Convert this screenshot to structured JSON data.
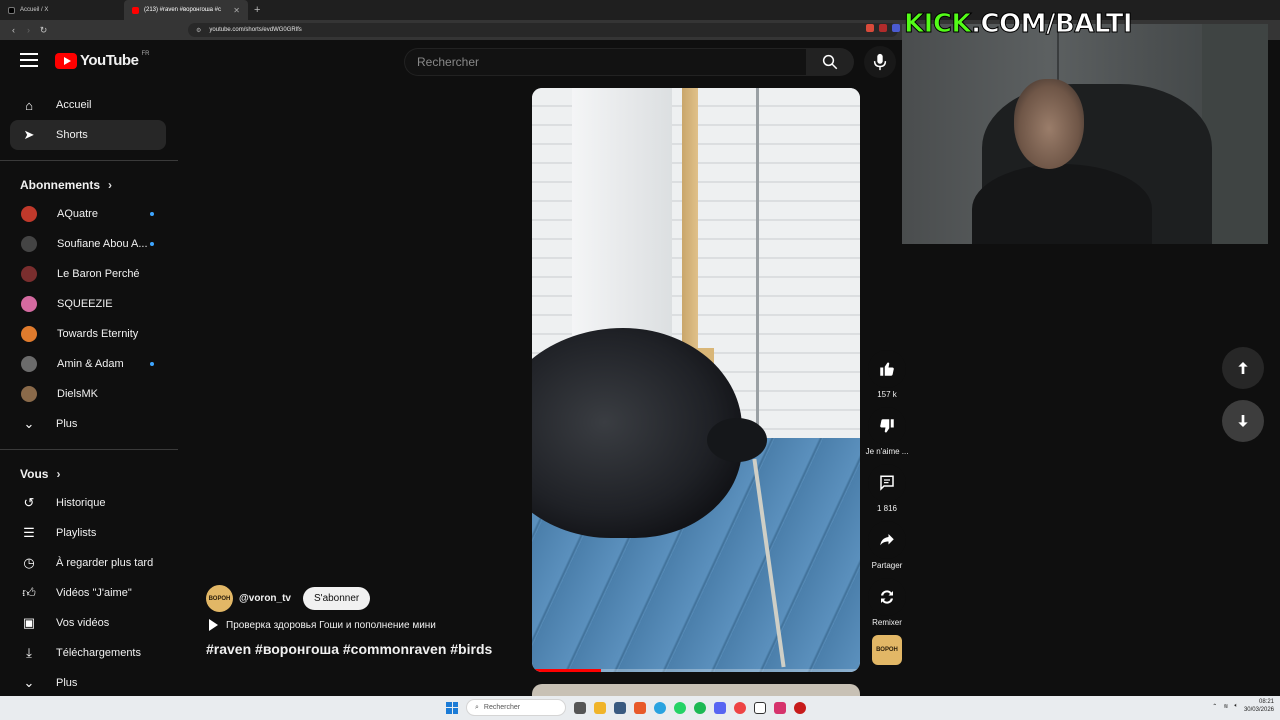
{
  "browser": {
    "tabs": [
      {
        "label": "Accueil / X",
        "active": false
      },
      {
        "label": "(213) #raven #воронгоша #c",
        "active": true
      }
    ],
    "url": "youtube.com/shorts/evdWG0GRlfs"
  },
  "header": {
    "logo_text": "YouTube",
    "country_code": "FR",
    "search_placeholder": "Rechercher"
  },
  "sidebar": {
    "main": [
      {
        "label": "Accueil",
        "icon": "home-icon"
      },
      {
        "label": "Shorts",
        "icon": "shorts-icon",
        "active": true
      }
    ],
    "subscriptions_title": "Abonnements",
    "subscriptions": [
      {
        "label": "AQuatre",
        "dot": true,
        "color": "#c0392b"
      },
      {
        "label": "Soufiane Abou A...",
        "dot": true,
        "color": "#555555"
      },
      {
        "label": "Le Baron Perché",
        "dot": false,
        "color": "#7a2e2e"
      },
      {
        "label": "SQUEEZIE",
        "dot": false,
        "color": "#d46aa0"
      },
      {
        "label": "Towards Eternity",
        "dot": false,
        "color": "#e07b2d"
      },
      {
        "label": "Amin & Adam",
        "dot": true,
        "color": "#6b6b6b"
      },
      {
        "label": "DielsMK",
        "dot": false,
        "color": "#8a6a4a"
      }
    ],
    "more_label": "Plus",
    "you_title": "Vous",
    "you_items": [
      {
        "label": "Historique",
        "icon": "history-icon"
      },
      {
        "label": "Playlists",
        "icon": "playlists-icon"
      },
      {
        "label": "À regarder plus tard",
        "icon": "watch-later-icon"
      },
      {
        "label": "Vidéos \"J'aime\"",
        "icon": "liked-videos-icon"
      },
      {
        "label": "Vos vidéos",
        "icon": "your-videos-icon"
      },
      {
        "label": "Téléchargements",
        "icon": "downloads-icon"
      }
    ],
    "more_label_2": "Plus"
  },
  "short": {
    "channel_handle": "@voron_tv",
    "channel_avatar_text": "ВОРОН",
    "subscribe_label": "S'abonner",
    "description": "Проверка здоровья Гоши и пополнение мини",
    "hashtags": "#raven #воронгоша #commonraven #birds",
    "progress": 0.21
  },
  "actions": {
    "likes": "157 k",
    "dislike_label": "Je n'aime ...",
    "comments": "1 816",
    "share_label": "Partager",
    "remix_label": "Remixer"
  },
  "overlay": {
    "kick_green": "KICK",
    "kick_rest": ".COM/BALTI"
  },
  "taskbar": {
    "search_placeholder": "Rechercher",
    "time": "08:21",
    "date": "30/03/2026"
  },
  "colors": {
    "accent_red": "#ff0000",
    "kick_green": "#53fc18",
    "background": "#0f0f0f"
  }
}
